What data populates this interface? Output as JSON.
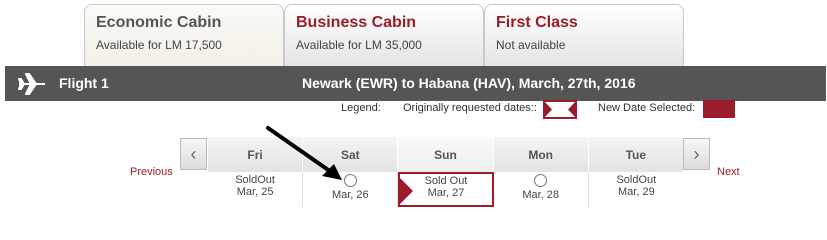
{
  "tabs": [
    {
      "title": "Economic Cabin",
      "subtitle": "Available for LM 17,500",
      "active": true
    },
    {
      "title": "Business Cabin",
      "subtitle": "Available for LM 35,000",
      "active": false
    },
    {
      "title": "First Class",
      "subtitle": "Not available",
      "active": false
    }
  ],
  "flight": {
    "label": "Flight 1",
    "route": "Newark (EWR) to Habana (HAV), March, 27th, 2016",
    "icon": "airplane-icon"
  },
  "legend": {
    "label": "Legend:",
    "original": "Originally requested dates::",
    "new": "New Date Selected:"
  },
  "nav": {
    "previous": "Previous",
    "next": "Next"
  },
  "days": [
    {
      "name": "Fri",
      "status": "SoldOut",
      "date": "Mar, 25"
    },
    {
      "name": "Sat",
      "status": "",
      "date": "Mar, 26"
    },
    {
      "name": "Sun",
      "status": "Sold Out",
      "date": "Mar, 27"
    },
    {
      "name": "Mon",
      "status": "",
      "date": "Mar, 28"
    },
    {
      "name": "Tue",
      "status": "SoldOut",
      "date": "Mar, 29"
    }
  ],
  "colors": {
    "accent": "#9b1d2c",
    "bar": "#555555"
  }
}
